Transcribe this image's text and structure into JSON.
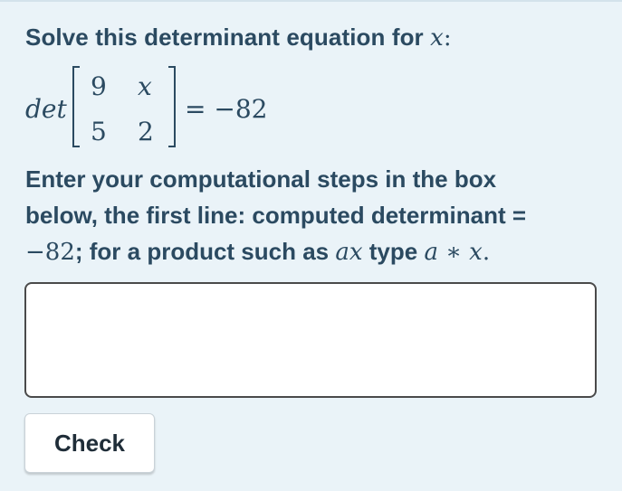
{
  "question": {
    "prompt_text": "Solve this determinant equation for ",
    "prompt_variable": "x",
    "prompt_suffix": ":"
  },
  "equation": {
    "det_label": "det",
    "matrix": [
      [
        "9",
        "x"
      ],
      [
        "5",
        "2"
      ]
    ],
    "rhs": "= −82"
  },
  "instructions": {
    "line1": "Enter your computational steps in the box",
    "line2": "below, the first line: computed determinant =",
    "line3_value": "−82",
    "line3_text": "; for a product such as ",
    "line3_example": "ax",
    "line3_type": " type ",
    "line3_syntax": "a ∗ x",
    "line3_end": "."
  },
  "answer_box": {
    "value": "",
    "placeholder": ""
  },
  "check_button": {
    "label": "Check"
  }
}
